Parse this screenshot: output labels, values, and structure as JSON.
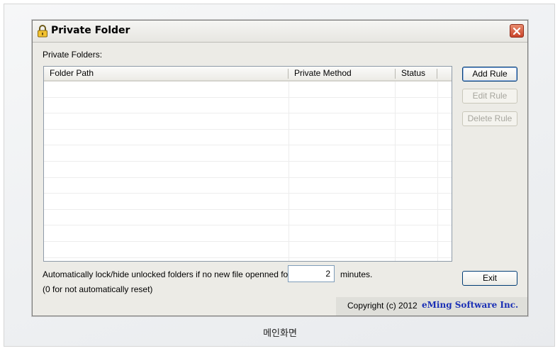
{
  "window": {
    "title": "Private Folder",
    "icon": "lock-icon",
    "close_icon": "close-icon",
    "close_color": "#d0452b"
  },
  "section_label": "Private Folders:",
  "list": {
    "columns": [
      "Folder Path",
      "Private Method",
      "Status"
    ],
    "rows": []
  },
  "buttons": {
    "add_rule": "Add Rule",
    "edit_rule": "Edit Rule",
    "delete_rule": "Delete Rule",
    "exit": "Exit"
  },
  "auto_lock": {
    "text": "Automatically lock/hide unlocked folders if no new file openned for",
    "value": "2",
    "unit": "minutes.",
    "note": "(0 for not automatically reset)"
  },
  "copyright": {
    "text": "Copyright (c) 2012",
    "company": "eMing Software Inc.",
    "company_color": "#1a2fb5"
  },
  "caption": "메인화면"
}
